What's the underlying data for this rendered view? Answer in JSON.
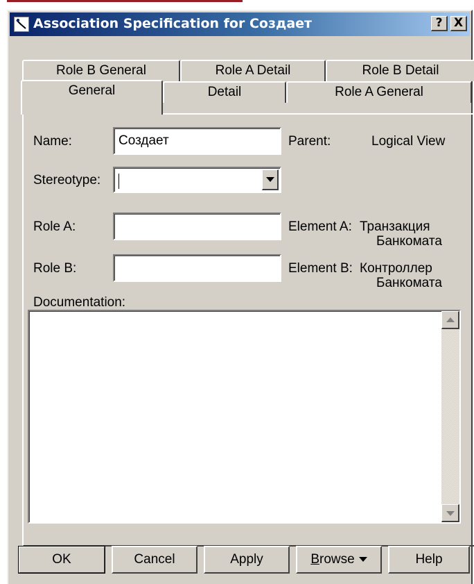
{
  "window": {
    "title": "Association Specification for Создает",
    "help_button": "?",
    "close_button": "X"
  },
  "tabs": {
    "back_row": [
      "Role B General",
      "Role A Detail",
      "Role B Detail"
    ],
    "front_row": [
      "General",
      "Detail",
      "Role A General"
    ],
    "active": "General"
  },
  "form": {
    "name_label": "Name:",
    "name_value": "Создает",
    "parent_label": "Parent:",
    "parent_value": "Logical View",
    "stereotype_label": "Stereotype:",
    "stereotype_value": "",
    "role_a_label": "Role A:",
    "role_a_value": "",
    "element_a_label": "Element A:",
    "element_a_value_line1": "Транзакция",
    "element_a_value_line2": "Банкомата",
    "role_b_label": "Role B:",
    "role_b_value": "",
    "element_b_label": "Element B:",
    "element_b_value_line1": "Контроллер",
    "element_b_value_line2": "Банкомата",
    "documentation_label": "Documentation:",
    "documentation_value": ""
  },
  "buttons": {
    "ok": "OK",
    "cancel": "Cancel",
    "apply": "Apply",
    "browse_first": "B",
    "browse_rest": "rowse",
    "help": "Help"
  },
  "colors": {
    "dialog_face": "#d4d0c8",
    "titlebar_start": "#0a246a",
    "titlebar_end": "#a6caf0"
  }
}
